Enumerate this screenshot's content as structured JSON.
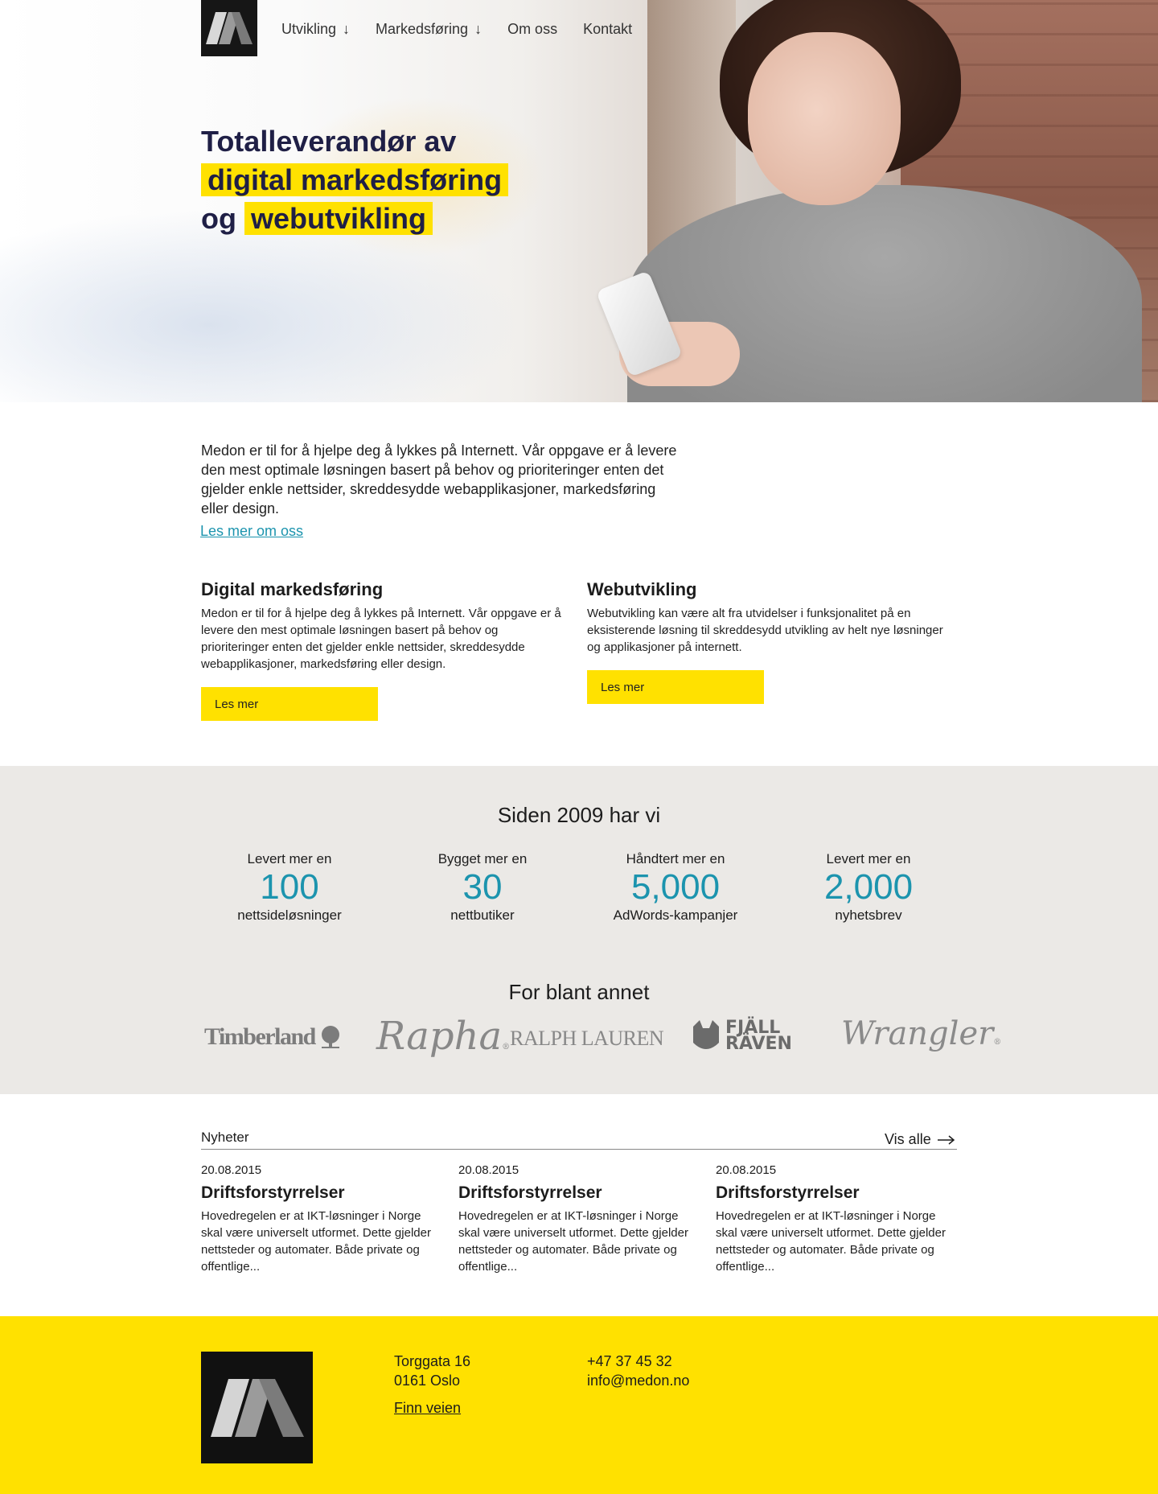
{
  "colors": {
    "accent_yellow": "#ffe100",
    "accent_teal": "#1c94ae",
    "dark_navy": "#1f1f46",
    "gray_band": "#ebe9e6"
  },
  "header": {
    "logo_icon": "medon-m-logo",
    "nav": [
      {
        "label": "Utvikling",
        "arrow": "↓"
      },
      {
        "label": "Markedsføring",
        "arrow": "↓"
      },
      {
        "label": "Om oss"
      },
      {
        "label": "Kontakt"
      }
    ]
  },
  "hero": {
    "line1": "Totalleverandør av",
    "line2_highlight": "digital markedsføring",
    "line3_prefix": "og",
    "line3_highlight": "webutvikling"
  },
  "intro": {
    "text": "Medon er til for å hjelpe deg å lykkes på Internett. Vår oppgave er å levere den mest optimale løsningen basert på behov og prioriteringer enten det gjelder enkle nettsider, skreddesydde webapplikasjoner, markedsføring eller design.",
    "link": "Les mer om oss"
  },
  "services": [
    {
      "title": "Digital markedsføring",
      "text": "Medon er til for å hjelpe deg å lykkes på Internett. Vår oppgave er å levere den mest optimale løsningen basert på behov og prioriteringer enten det gjelder enkle nettsider, skreddesydde webapplikasjoner, markedsføring eller design.",
      "button": "Les mer"
    },
    {
      "title": "Webutvikling",
      "text": "Webutvikling kan være alt fra utvidelser i funksjonalitet på en eksisterende løsning til skreddesydd utvikling av helt nye løsninger og applikasjoner på internett.",
      "button": "Les mer"
    }
  ],
  "stats": {
    "heading": "Siden 2009 har vi",
    "items": [
      {
        "pre": "Levert mer en",
        "num": "100",
        "post": "nettsideløsninger"
      },
      {
        "pre": "Bygget mer en",
        "num": "30",
        "post": "nettbutiker"
      },
      {
        "pre": "Håndtert mer en",
        "num": "5,000",
        "post": "AdWords-kampanjer"
      },
      {
        "pre": "Levert mer en",
        "num": "2,000",
        "post": "nyhetsbrev"
      }
    ],
    "clients_heading": "For blant annet",
    "clients": [
      "Timberland",
      "Rapha",
      "RALPH LAUREN",
      "FJÄLL RÄVEN",
      "Wrangler"
    ]
  },
  "news": {
    "heading": "Nyheter",
    "view_all": "Vis alle",
    "items": [
      {
        "date": "20.08.2015",
        "title": "Driftsforstyrrelser",
        "text": "Hovedregelen er at IKT-løsninger i Norge skal være universelt utformet. Dette gjelder nettsteder og automater. Både private og offentlige..."
      },
      {
        "date": "20.08.2015",
        "title": "Driftsforstyrrelser",
        "text": "Hovedregelen er at IKT-løsninger i Norge skal være universelt utformet. Dette gjelder nettsteder og automater. Både private og offentlige..."
      },
      {
        "date": "20.08.2015",
        "title": "Driftsforstyrrelser",
        "text": "Hovedregelen er at IKT-løsninger i Norge skal være universelt utformet. Dette gjelder nettsteder og automater. Både private og offentlige..."
      }
    ]
  },
  "footer": {
    "street": "Torggata 16",
    "city": "0161 Oslo",
    "map_link": "Finn veien",
    "phone": "+47 37 45 32",
    "email": "info@medon.no"
  }
}
